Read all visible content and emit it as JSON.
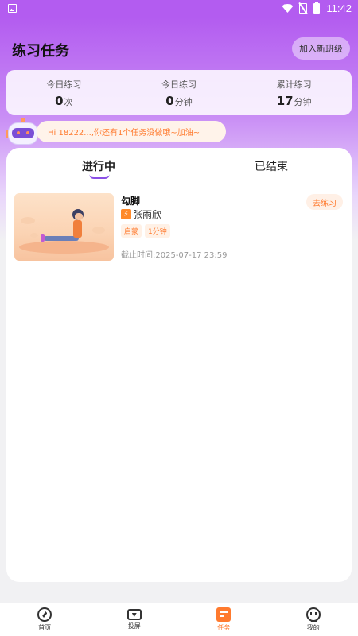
{
  "status_bar": {
    "time": "11:42"
  },
  "header": {
    "title": "练习任务",
    "join_button": "加入新班级"
  },
  "stats": [
    {
      "label": "今日练习",
      "value": "0",
      "unit": "次"
    },
    {
      "label": "今日练习",
      "value": "0",
      "unit": "分钟"
    },
    {
      "label": "累计练习",
      "value": "17",
      "unit": "分钟"
    }
  ],
  "notice": "Hi 18222...,你还有1个任务没做哦~加油~",
  "tabs": {
    "active": "进行中",
    "inactive": "已结束"
  },
  "task": {
    "title": "勾脚",
    "teacher": "张雨欣",
    "teacher_icon": "lightning-icon",
    "tags": [
      "启蒙",
      "1分钟"
    ],
    "deadline": "截止时间:2025-07-17 23:59",
    "action": "去练习"
  },
  "bottom_nav": [
    {
      "label": "首页",
      "icon": "compass-icon"
    },
    {
      "label": "投屏",
      "icon": "screen-cast-icon"
    },
    {
      "label": "任务",
      "icon": "task-icon",
      "active": true
    },
    {
      "label": "我的",
      "icon": "profile-icon"
    }
  ],
  "colors": {
    "accent": "#ff7a2e",
    "purple": "#b35cf0",
    "tab_underline": "#8a4fe6"
  }
}
